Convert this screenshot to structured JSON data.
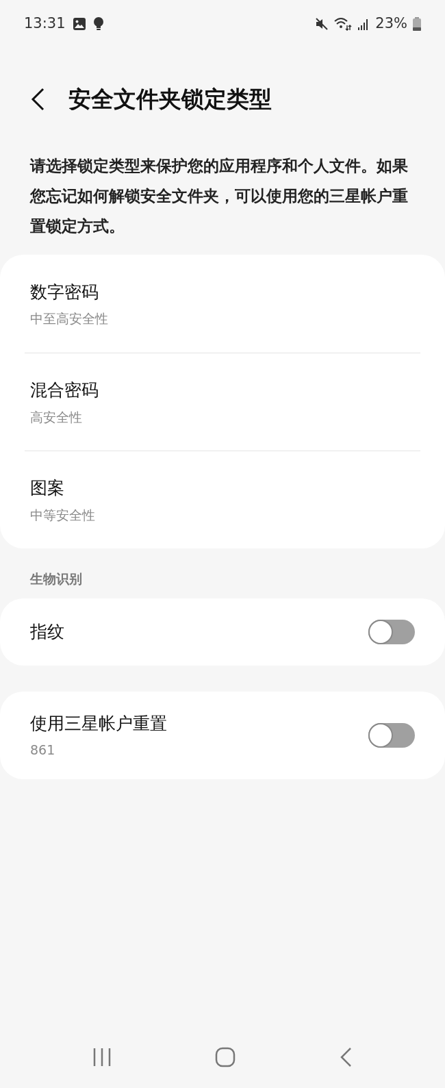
{
  "status_bar": {
    "time": "13:31",
    "battery": "23%"
  },
  "header": {
    "title": "安全文件夹锁定类型"
  },
  "description": "请选择锁定类型来保护您的应用程序和个人文件。如果您忘记如何解锁安全文件夹，可以使用您的三星帐户重置锁定方式。",
  "lock_types": [
    {
      "title": "数字密码",
      "subtitle": "中至高安全性"
    },
    {
      "title": "混合密码",
      "subtitle": "高安全性"
    },
    {
      "title": "图案",
      "subtitle": "中等安全性"
    }
  ],
  "biometrics": {
    "label": "生物识别",
    "items": [
      {
        "title": "指纹",
        "on": false
      }
    ]
  },
  "account_reset": {
    "title": "使用三星帐户重置",
    "subtitle": "861",
    "on": false
  }
}
